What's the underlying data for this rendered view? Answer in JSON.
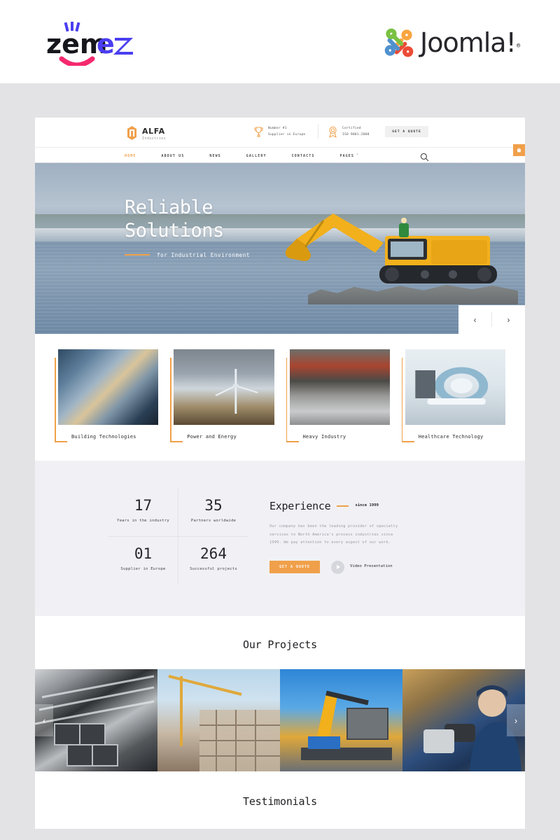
{
  "topbar": {
    "zemes_logo_text": "zemez",
    "joomla_logo_text": "Joomla!",
    "joomla_reg": "®"
  },
  "site_header": {
    "brand_name": "ALFA",
    "brand_sub": "Industries",
    "info": [
      {
        "icon": "trophy-icon",
        "line1": "Number #1",
        "line2": "Supplier in Europe"
      },
      {
        "icon": "award-badge-icon",
        "line1": "Certified",
        "line2": "ISO 9001:2008"
      }
    ],
    "quote_button": "GET A QUOTE",
    "side_tab_icon": "cart-icon"
  },
  "nav": {
    "items": [
      {
        "label": "HOME",
        "active": true
      },
      {
        "label": "ABOUT US",
        "active": false
      },
      {
        "label": "NEWS",
        "active": false
      },
      {
        "label": "GALLERY",
        "active": false
      },
      {
        "label": "CONTACTS",
        "active": false
      },
      {
        "label": "PAGES",
        "active": false,
        "caret": "ˇ"
      }
    ],
    "search_icon": "search-icon"
  },
  "hero": {
    "title_line1": "Reliable",
    "title_line2": "Solutions",
    "subtitle": "for Industrial Environment",
    "prev": "‹",
    "next": "›"
  },
  "categories": [
    {
      "label": "Building Technologies",
      "image_class": "im-building"
    },
    {
      "label": "Power and Energy",
      "image_class": "im-power"
    },
    {
      "label": "Heavy Industry",
      "image_class": "im-heavy"
    },
    {
      "label": "Healthcare Technology",
      "image_class": "im-health"
    }
  ],
  "experience": {
    "stats": [
      {
        "number": "17",
        "label": "Years in the industry"
      },
      {
        "number": "35",
        "label": "Partners worldwide"
      },
      {
        "number": "01",
        "label": "Supplier in Europe"
      },
      {
        "number": "264",
        "label": "Successful projects"
      }
    ],
    "title": "Experience",
    "since": "since 1999",
    "paragraph": "Our company has been the leading provider of specialty services to North America's process industries since 1999. We pay attention to every aspect of our work.",
    "quote_button": "GET A QUOTE",
    "video_label": "Video Presentation",
    "play_icon": "play-icon"
  },
  "projects": {
    "title": "Our Projects",
    "prev": "‹",
    "next": "›",
    "items": [
      {
        "alt": "stacked steel beams",
        "class": "p1"
      },
      {
        "alt": "construction crane building",
        "class": "p2"
      },
      {
        "alt": "crane lifting container",
        "class": "p3"
      },
      {
        "alt": "worker operating machine",
        "class": "p4"
      }
    ]
  },
  "testimonials": {
    "title": "Testimonials"
  },
  "colors": {
    "accent": "#f0a04a",
    "page_bg": "#e3e3e5",
    "section_bg": "#f1f1f5"
  }
}
